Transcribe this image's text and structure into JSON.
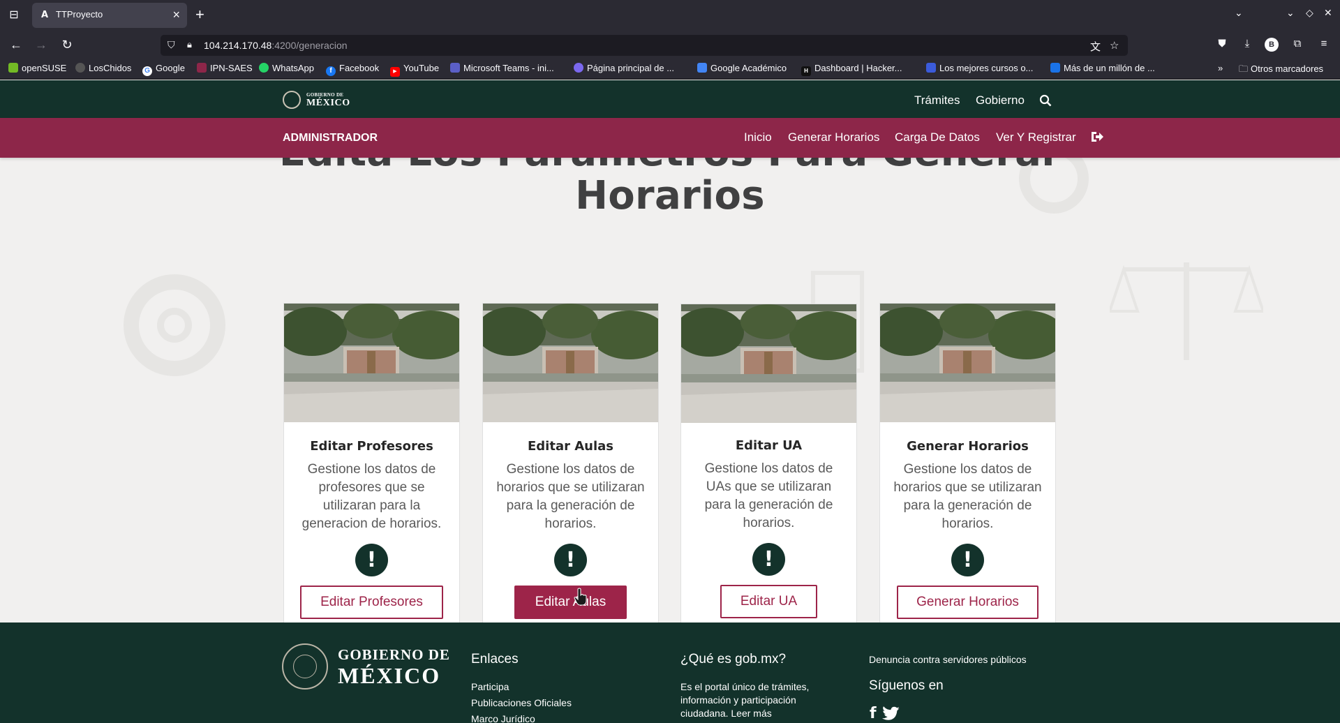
{
  "browser": {
    "tab_title": "TTProyecto",
    "tab_favicon": "A",
    "url_host": "104.214.170.48",
    "url_rest": ":4200/generacion",
    "bookmarks": [
      {
        "label": "openSUSE",
        "color": "#73ba25"
      },
      {
        "label": "LosChidos",
        "color": "#555"
      },
      {
        "label": "Google",
        "color": "#4285f4"
      },
      {
        "label": "IPN-SAES",
        "color": "#8d2649"
      },
      {
        "label": "WhatsApp",
        "color": "#25d366"
      },
      {
        "label": "Facebook",
        "color": "#1877f2"
      },
      {
        "label": "YouTube",
        "color": "#ff0000"
      },
      {
        "label": "Microsoft Teams - ini...",
        "color": "#5b5fc7"
      },
      {
        "label": "Página principal de ...",
        "color": "#7b68ee"
      },
      {
        "label": "Google Académico",
        "color": "#4285f4"
      },
      {
        "label": "Dashboard | Hacker...",
        "color": "#111"
      },
      {
        "label": "Los mejores cursos o...",
        "color": "#3b5bdb"
      },
      {
        "label": "Más de un millón de ...",
        "color": "#1a73e8"
      }
    ],
    "other_bookmarks": "Otros marcadores"
  },
  "header": {
    "logo_line1": "GOBIERNO DE",
    "logo_line2": "MÉXICO",
    "nav": [
      "Trámites",
      "Gobierno"
    ]
  },
  "adminbar": {
    "brand": "ADMINISTRADOR",
    "items": [
      "Inicio",
      "Generar Horarios",
      "Carga De Datos",
      "Ver Y Registrar"
    ]
  },
  "main": {
    "title": "Edita Los Parametros Para Generar Horarios",
    "cards": [
      {
        "title": "Editar Profesores",
        "description": "Gestione los datos de profesores que se utilizaran para la generacion de horarios.",
        "button": "Editar Profesores"
      },
      {
        "title": "Editar Aulas",
        "description": "Gestione los datos de horarios que se utilizaran para la generación de horarios.",
        "button": "Editar Aulas"
      },
      {
        "title": "Editar UA",
        "description": "Gestione los datos de UAs que se utilizaran para la generación de horarios.",
        "button": "Editar UA"
      },
      {
        "title": "Generar Horarios",
        "description": "Gestione los datos de horarios que se utilizaran para la generación de horarios.",
        "button": "Generar Horarios"
      }
    ],
    "alert_glyph": "!"
  },
  "footer": {
    "logo_line1": "GOBIERNO DE",
    "logo_line2": "MÉXICO",
    "links_heading": "Enlaces",
    "links": [
      "Participa",
      "Publicaciones Oficiales",
      "Marco Jurídico"
    ],
    "about_heading": "¿Qué es gob.mx?",
    "about_text": "Es el portal único de trámites, información y participación ciudadana. Leer más",
    "denuncia": "Denuncia contra servidores públicos",
    "follow_heading": "Síguenos en"
  },
  "colors": {
    "gov_green": "#13322b",
    "gov_wine": "#9d2449",
    "admin_bar": "#8d2649"
  }
}
